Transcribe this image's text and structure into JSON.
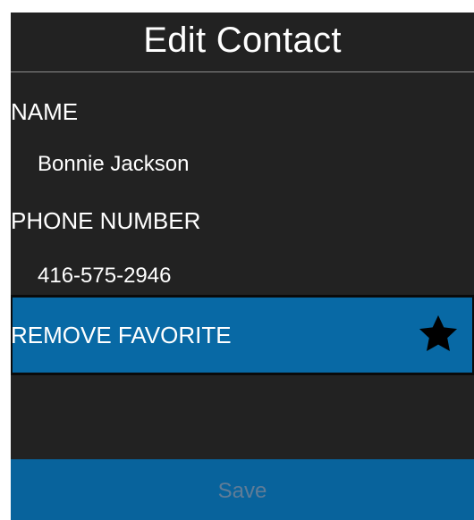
{
  "app": {
    "title": "Edit Contact"
  },
  "contact": {
    "name_label": "NAME",
    "name_value": "Bonnie Jackson",
    "phone_label": "PHONE NUMBER",
    "phone_value": "416-575-2946"
  },
  "favorite": {
    "label": "REMOVE FAVORITE",
    "icon": "star-icon",
    "state": "favorite"
  },
  "footer": {
    "save_label": "Save"
  },
  "colors": {
    "background": "#222222",
    "accent": "#0869a5",
    "save_bar": "#08639c",
    "text": "#ffffff",
    "disabled_text": "#5f7c97"
  }
}
